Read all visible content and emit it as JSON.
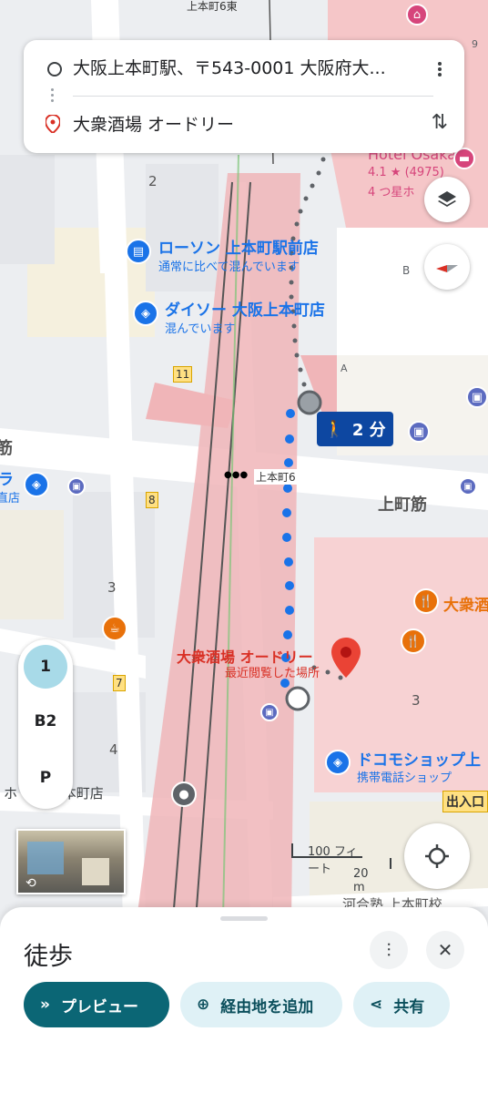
{
  "route": {
    "origin": "大阪上本町駅、〒543-0001 大阪府大...",
    "destination": "大衆酒場 オードリー"
  },
  "map": {
    "top_labels": {
      "intersection": "上本町6東"
    },
    "hotel": {
      "name": "Hotel Osaka",
      "rating": "4.1 ★ (4975)",
      "stars": "4 つ星ホ"
    },
    "lawson": {
      "name": "ローソン 上本町駅前店",
      "crowd": "通常に比べて混んでいます"
    },
    "daiso": {
      "name": "ダイソー 大阪上本町店",
      "crowd": "混んでいます"
    },
    "walk_badge": "2 分",
    "intersection": "上本町6",
    "street": "上町筋",
    "street_left": "筋",
    "left_cut": "ラ",
    "left_cut2": "直店",
    "dest": {
      "name": "大衆酒場 オードリー",
      "sub": "最近閲覧した場所"
    },
    "restaurant": "大衆酒",
    "docomo": {
      "name": "ドコモショップ上",
      "sub": "携帯電話ショップ"
    },
    "station_shop": "ホ   ック上本町店",
    "exit": "出入口",
    "kawai": "河合塾 上本町校",
    "blocks": [
      "2",
      "3",
      "4",
      "3"
    ],
    "exits": [
      "11",
      "8",
      "7"
    ],
    "marker_b": "B",
    "marker_a": "A",
    "marker_9": "9"
  },
  "floors": [
    "1",
    "B2",
    "P"
  ],
  "scale": {
    "ft": "100 フィート",
    "m": "20 m"
  },
  "sheet": {
    "title": "徒歩",
    "preview": "プレビュー",
    "add_stop": "経由地を追加",
    "share": "共有"
  },
  "colors": {
    "accent": "#0b6675",
    "route": "#1a73e8",
    "pin": "#d93025"
  }
}
